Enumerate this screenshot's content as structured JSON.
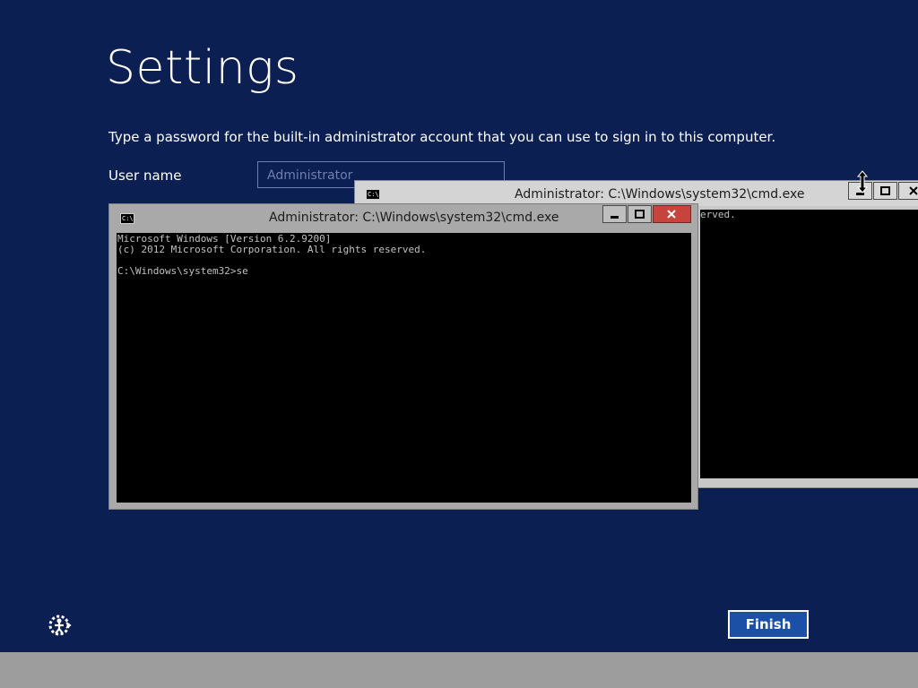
{
  "page": {
    "title": "Settings",
    "description": "Type a password for the built-in administrator account that you can use to sign in to this computer.",
    "user_name_label": "User name",
    "user_name_value": "Administrator",
    "finish_label": "Finish",
    "ease_of_access_icon": "ease-of-access-icon"
  },
  "back_window": {
    "title": "Administrator: C:\\Windows\\system32\\cmd.exe",
    "icon_text": "C:\\",
    "console_text": "erved."
  },
  "front_window": {
    "title": "Administrator: C:\\Windows\\system32\\cmd.exe",
    "icon_text": "C:\\",
    "console_text": "Microsoft Windows [Version 6.2.9200]\n(c) 2012 Microsoft Corporation. All rights reserved.\n\nC:\\Windows\\system32>se"
  },
  "colors": {
    "background": "#0c1f52",
    "close_button": "#c8433b",
    "finish_button": "#1c4fa6"
  }
}
